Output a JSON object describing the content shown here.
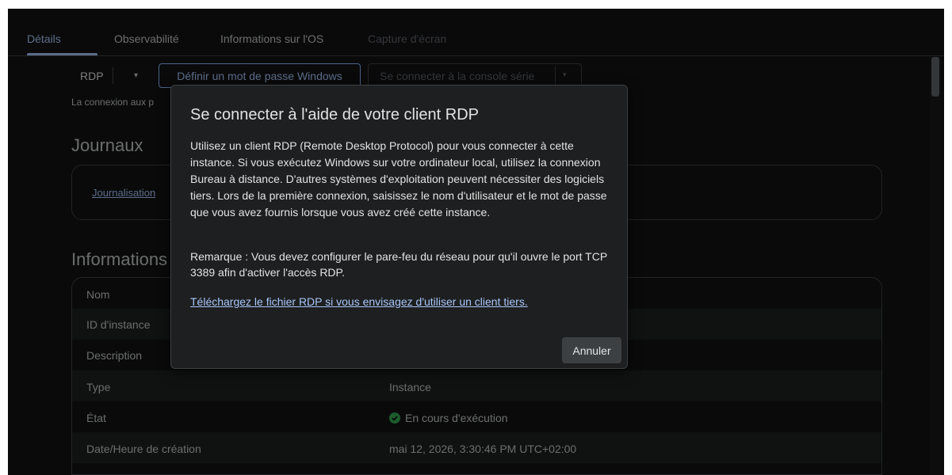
{
  "tabs": [
    {
      "label": "Détails"
    },
    {
      "label": "Observabilité"
    },
    {
      "label": "Informations sur l'OS"
    },
    {
      "label": "Capture d'écran"
    }
  ],
  "toolbar": {
    "rdp_label": "RDP",
    "rdp_caret": "▾",
    "set_password_label": "Définir un mot de passe Windows",
    "serial_console_label": "Se connecter à la console série",
    "serial_caret": "▾"
  },
  "connection_text": "La connexion aux p",
  "logs": {
    "title": "Journaux",
    "link_label": "Journalisation"
  },
  "info": {
    "title": "Informations",
    "rows": [
      {
        "label": "Nom",
        "value": ""
      },
      {
        "label": "ID d'instance",
        "value": ""
      },
      {
        "label": "Description",
        "value": ""
      },
      {
        "label": "Type",
        "value": "Instance"
      },
      {
        "label": "État",
        "value": "En cours d'exécution",
        "status_color": "#34a853"
      },
      {
        "label": "Date/Heure de création",
        "value": "mai 12, 2026, 3:30:46 PM UTC+02:00"
      }
    ]
  },
  "dialog": {
    "title": "Se connecter à l'aide de votre client RDP",
    "body": "Utilisez un client RDP (Remote Desktop Protocol) pour vous connecter à cette instance. Si vous exécutez Windows sur votre ordinateur local, utilisez la connexion Bureau à distance. D'autres systèmes d'exploitation peuvent nécessiter des logiciels tiers. Lors de la première connexion, saisissez le nom d'utilisateur et le mot de passe que vous avez fournis lorsque vous avez créé cette instance.",
    "note": "Remarque : Vous devez configurer le pare-feu du réseau pour qu'il ouvre le port TCP 3389 afin d'activer l'accès RDP.",
    "download_link": "Téléchargez le fichier RDP si vous envisagez d'utiliser un client tiers.",
    "cancel_label": "Annuler"
  },
  "colors": {
    "accent": "#a8c7fa",
    "background": "#131314",
    "dialog_bg": "#1e1f20",
    "success": "#34a853"
  }
}
